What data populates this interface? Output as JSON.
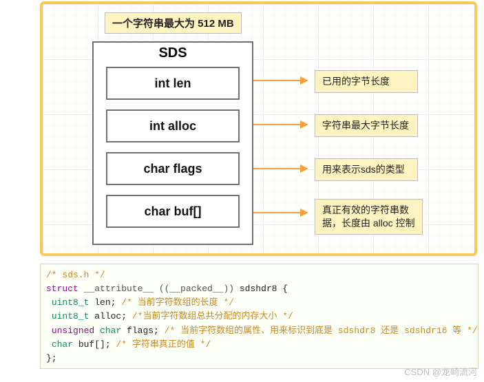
{
  "diagram": {
    "header_note": "一个字符串最大为 512 MB",
    "sds_title": "SDS",
    "fields": {
      "len": {
        "label": "int len",
        "annotation": "已用的字节长度"
      },
      "alloc": {
        "label": "int alloc",
        "annotation": "字符串最大字节长度"
      },
      "flags": {
        "label": "char flags",
        "annotation": "用来表示sds的类型"
      },
      "buf": {
        "label": "char buf[]",
        "annotation": "真正有效的字符串数\n据，长度由 alloc 控制"
      }
    }
  },
  "code": {
    "line1_comment": "/* sds.h */",
    "struct_kw": "struct",
    "attr1": "__attribute__",
    "attr2_open": " ((",
    "attr2_packed": "__packed__",
    "attr2_close": ")) ",
    "struct_name": "sdshdr8 {",
    "len_type": "uint8_t",
    "len_name": " len; ",
    "len_comment": "/*  当前字符数组的长度  */",
    "alloc_type": "uint8_t",
    "alloc_name": " alloc; ",
    "alloc_comment": "/*当前字符数组总共分配的内存大小  */",
    "flags_kw1": "unsigned",
    "flags_kw2": " char",
    "flags_name": " flags; ",
    "flags_comment": "/*  当前字符数组的属性、用来标识到底是 sdshdr8 还是 sdshdr16 等  */",
    "buf_kw": "char",
    "buf_name": " buf[]; ",
    "buf_comment": "/*  字符串真正的值  */",
    "close_brace": "};"
  },
  "watermark": "CSDN @龙崎流河"
}
